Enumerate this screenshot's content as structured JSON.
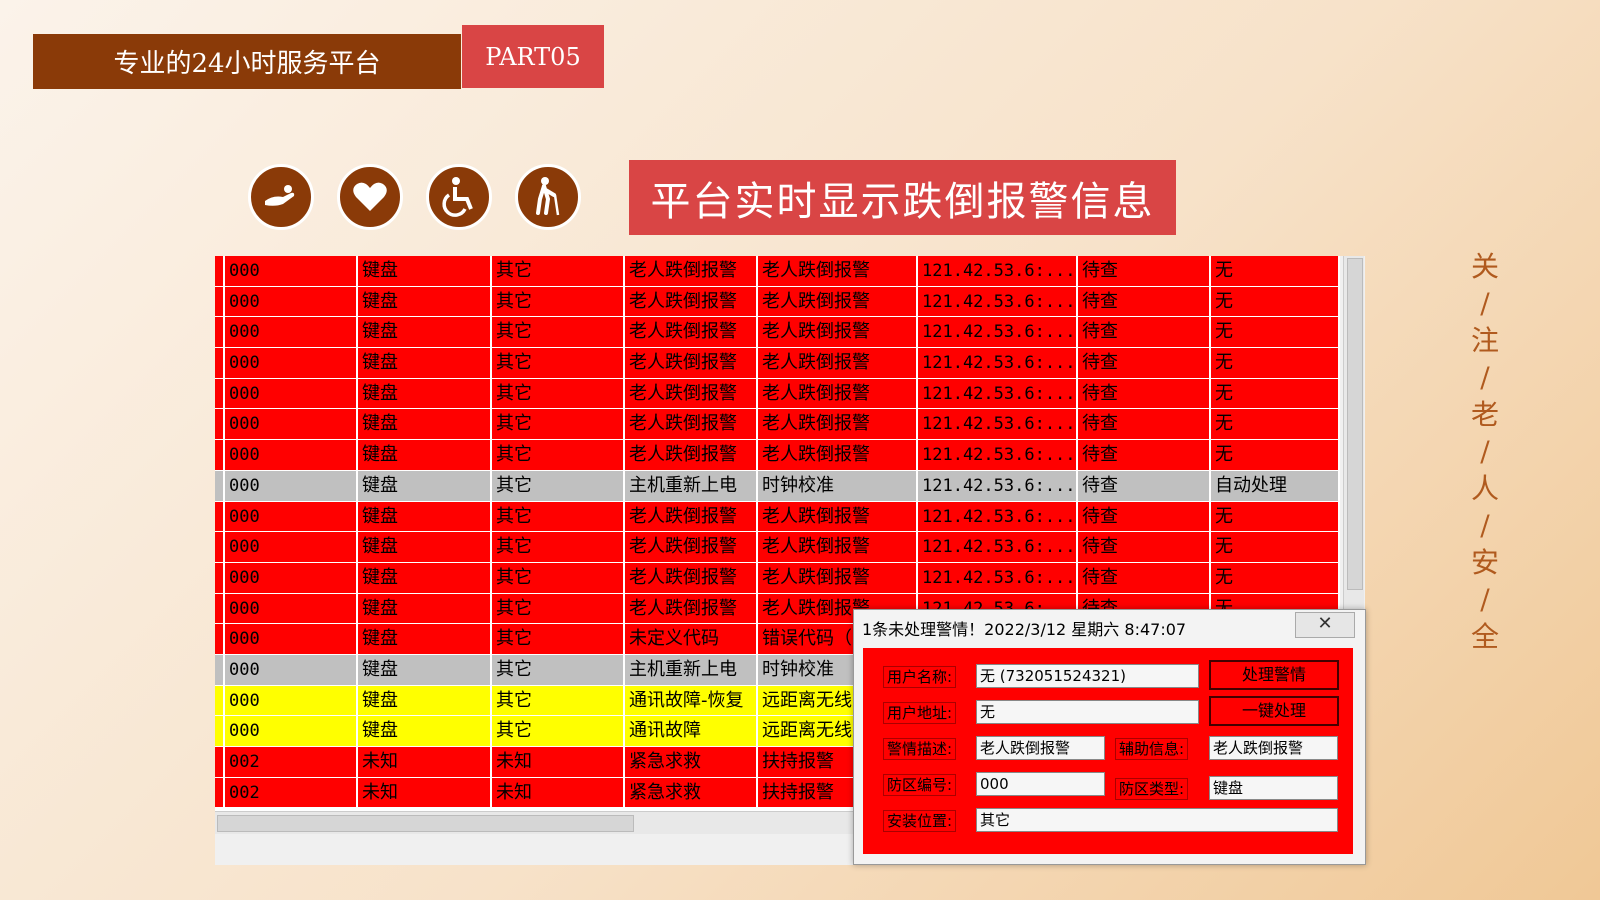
{
  "header": {
    "title": "专业的24小时服务平台",
    "part": "PART05"
  },
  "icons": [
    "helping-hand-icon",
    "heart-icon",
    "wheelchair-icon",
    "elderly-person-icon"
  ],
  "banner": "平台实时显示跌倒报警信息",
  "side_text": [
    "关",
    "/",
    "注",
    "/",
    "老",
    "/",
    "人",
    "/",
    "安",
    "/",
    "全"
  ],
  "colors": {
    "accent_brown": "#8a3a08",
    "accent_red": "#d94545",
    "alarm_red": "#ff0000",
    "alarm_gray": "#c0c0c0",
    "alarm_yellow": "#ffff00"
  },
  "table": {
    "rows": [
      {
        "status": "red",
        "cells": [
          "000",
          "键盘",
          "其它",
          "老人跌倒报警",
          "老人跌倒报警",
          "121.42.53.6:...",
          "待查",
          "无"
        ]
      },
      {
        "status": "red",
        "cells": [
          "000",
          "键盘",
          "其它",
          "老人跌倒报警",
          "老人跌倒报警",
          "121.42.53.6:...",
          "待查",
          "无"
        ]
      },
      {
        "status": "red",
        "cells": [
          "000",
          "键盘",
          "其它",
          "老人跌倒报警",
          "老人跌倒报警",
          "121.42.53.6:...",
          "待查",
          "无"
        ]
      },
      {
        "status": "red",
        "cells": [
          "000",
          "键盘",
          "其它",
          "老人跌倒报警",
          "老人跌倒报警",
          "121.42.53.6:...",
          "待查",
          "无"
        ]
      },
      {
        "status": "red",
        "cells": [
          "000",
          "键盘",
          "其它",
          "老人跌倒报警",
          "老人跌倒报警",
          "121.42.53.6:...",
          "待查",
          "无"
        ]
      },
      {
        "status": "red",
        "cells": [
          "000",
          "键盘",
          "其它",
          "老人跌倒报警",
          "老人跌倒报警",
          "121.42.53.6:...",
          "待查",
          "无"
        ]
      },
      {
        "status": "red",
        "cells": [
          "000",
          "键盘",
          "其它",
          "老人跌倒报警",
          "老人跌倒报警",
          "121.42.53.6:...",
          "待查",
          "无"
        ]
      },
      {
        "status": "gray",
        "cells": [
          "000",
          "键盘",
          "其它",
          "主机重新上电",
          "时钟校准",
          "121.42.53.6:...",
          "待查",
          "自动处理"
        ]
      },
      {
        "status": "red",
        "cells": [
          "000",
          "键盘",
          "其它",
          "老人跌倒报警",
          "老人跌倒报警",
          "121.42.53.6:...",
          "待查",
          "无"
        ]
      },
      {
        "status": "red",
        "cells": [
          "000",
          "键盘",
          "其它",
          "老人跌倒报警",
          "老人跌倒报警",
          "121.42.53.6:...",
          "待查",
          "无"
        ]
      },
      {
        "status": "red",
        "cells": [
          "000",
          "键盘",
          "其它",
          "老人跌倒报警",
          "老人跌倒报警",
          "121.42.53.6:...",
          "待查",
          "无"
        ]
      },
      {
        "status": "red",
        "cells": [
          "000",
          "键盘",
          "其它",
          "老人跌倒报警",
          "老人跌倒报警",
          "121.42.53.6:...",
          "待查",
          "无"
        ]
      },
      {
        "status": "red",
        "cells": [
          "000",
          "键盘",
          "其它",
          "未定义代码",
          "错误代码（",
          "",
          "",
          ""
        ]
      },
      {
        "status": "gray",
        "cells": [
          "000",
          "键盘",
          "其它",
          "主机重新上电",
          "时钟校准",
          "",
          "",
          ""
        ]
      },
      {
        "status": "yellow",
        "cells": [
          "000",
          "键盘",
          "其它",
          "通讯故障-恢复",
          "远距离无线",
          "",
          "",
          ""
        ]
      },
      {
        "status": "yellow",
        "cells": [
          "000",
          "键盘",
          "其它",
          "通讯故障",
          "远距离无线",
          "",
          "",
          ""
        ]
      },
      {
        "status": "red",
        "cells": [
          "002",
          "未知",
          "未知",
          "紧急求救",
          "扶持报警",
          "",
          "",
          ""
        ]
      },
      {
        "status": "red",
        "cells": [
          "002",
          "未知",
          "未知",
          "紧急求救",
          "扶持报警",
          "",
          "",
          ""
        ]
      }
    ]
  },
  "dialog": {
    "title": "1条未处理警情！2022/3/12 星期六 8:47:07",
    "close": "✕",
    "user_name_label": "用户名称:",
    "user_name_value": "无 (732051524321)",
    "user_addr_label": "用户地址:",
    "user_addr_value": "无",
    "alarm_desc_label": "警情描述:",
    "alarm_desc_value": "老人跌倒报警",
    "aux_info_label": "辅助信息:",
    "aux_info_value": "老人跌倒报警",
    "zone_no_label": "防区编号:",
    "zone_no_value": "000",
    "zone_type_label": "防区类型:",
    "zone_type_value": "键盘",
    "install_loc_label": "安装位置:",
    "install_loc_value": "其它",
    "handle_button": "处理警情",
    "one_click_button": "一键处理"
  }
}
